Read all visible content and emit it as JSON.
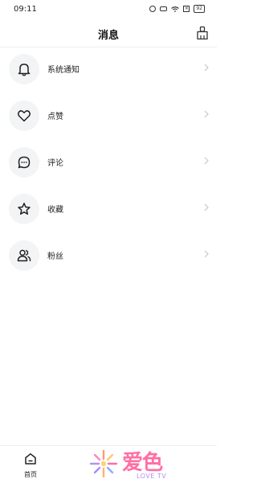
{
  "status_bar": {
    "time": "09:11",
    "battery": "92"
  },
  "header": {
    "title": "消息"
  },
  "menu": [
    {
      "label": "系统通知",
      "icon": "bell-icon"
    },
    {
      "label": "点赞",
      "icon": "heart-icon"
    },
    {
      "label": "评论",
      "icon": "comment-icon"
    },
    {
      "label": "收藏",
      "icon": "star-icon"
    },
    {
      "label": "粉丝",
      "icon": "users-icon"
    }
  ],
  "tabbar": {
    "home_label": "首页"
  },
  "logo": {
    "text": "爱色",
    "sub": "LOVE TV"
  },
  "colors": {
    "icon_bg": "#f3f4f6",
    "logo_pink": "#ff6fa3",
    "logo_purple": "#b88ef7"
  }
}
